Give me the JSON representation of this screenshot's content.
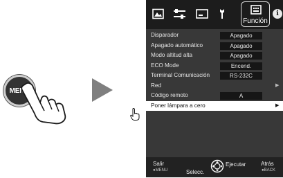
{
  "remote": {
    "menu_button_label": "MENU"
  },
  "tabs": {
    "icons": [
      "picture-icon",
      "adjust-sliders-icon",
      "display-icon",
      "settings-wrench-icon"
    ],
    "active_label": "Función",
    "active_icon": "function-keyboard-icon",
    "info_icon": "i"
  },
  "menu_rows": [
    {
      "label": "Disparador",
      "value": "Apagado"
    },
    {
      "label": "Apagado automático",
      "value": "Apagado"
    },
    {
      "label": "Modo altitud alta",
      "value": "Apagado"
    },
    {
      "label": "ECO Mode",
      "value": "Encend."
    },
    {
      "label": "Terminal Comunicación",
      "value": "RS-232C"
    },
    {
      "label": "Red",
      "submenu": true
    },
    {
      "label": "Código remoto",
      "value": "A"
    },
    {
      "label": "Poner lámpara a cero",
      "submenu": true,
      "selected": true
    }
  ],
  "footer": {
    "exit_label": "Salir",
    "exit_key": "●MENU",
    "select_label": "Selecc.",
    "execute_label": "Ejecutar",
    "back_label": "Atrás",
    "back_key": "●BACK"
  },
  "colors": {
    "panel_bg": "#383838",
    "tabbar_bg": "#1c1c1c",
    "value_bg": "#161616",
    "arrow": "#7f7f7f"
  }
}
